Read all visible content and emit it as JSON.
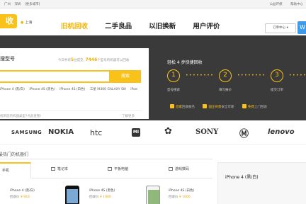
{
  "topbar": {
    "cities": [
      "广州",
      "深圳",
      "[更多城市]"
    ],
    "links": [
      "公益环保",
      "帮助中心"
    ]
  },
  "header": {
    "logo": "收",
    "location": "上海",
    "nav": [
      "旧机回收",
      "二手良品",
      "以旧换新",
      "用户评价"
    ],
    "order_center": "订单中心",
    "side_button": "W"
  },
  "search": {
    "title": "搜型号",
    "stat_prefix": "今日共有",
    "stat_count": "5",
    "stat_mid": "台成交,",
    "stat_models": "7446",
    "stat_suffix": "个型号的机器可以回收",
    "placeholder": "",
    "button": "搜索",
    "hot": [
      "iPhone 4 (黑/白)",
      "iPhone 4S (黑色)",
      "iPhone 4S (白色)",
      "三星 I9300 GALAXY SIII",
      "iPod"
    ],
    "footer_left": "找到您的机器类型?点此查看!",
    "footer_right": "了解更多"
  },
  "steps": {
    "title": "轻松 4 步快捷回收",
    "items": [
      {
        "num": "1",
        "label": "型号搜索"
      },
      {
        "num": "2",
        "label": "填写报价"
      },
      {
        "num": "3",
        "label": "提交订单"
      }
    ],
    "features": [
      {
        "label": "首家",
        "text": "回收服务"
      },
      {
        "label": "国企背景",
        "text": "安全可靠"
      },
      {
        "label": "免费",
        "text": "上门回收"
      }
    ]
  },
  "brands": [
    "SAMSUNG",
    "NOKIA",
    "htc",
    "MI",
    "HUAWEI",
    "SONY",
    "MOTOROLA",
    "lenovo"
  ],
  "products": {
    "section_title": "最热门的机器们",
    "tabs": [
      "手机",
      "笔记本",
      "平板电脑",
      "游戏数码"
    ],
    "items": [
      {
        "name": "iPhone 4 (黑/白)",
        "price_label": "回收价",
        "price": "¥ 943"
      },
      {
        "name": "iPhone 4S (黑色)",
        "price_label": "回收价",
        "price": "¥ 1000"
      },
      {
        "name": "iPhone 4S (白色)",
        "price_label": "回收价",
        "price": "¥ 1000"
      }
    ],
    "side_name": "iPhone 4 (黑/白)"
  },
  "colors": {
    "accent": "#f8c21b",
    "hero_bg": "#3a3a3a"
  }
}
